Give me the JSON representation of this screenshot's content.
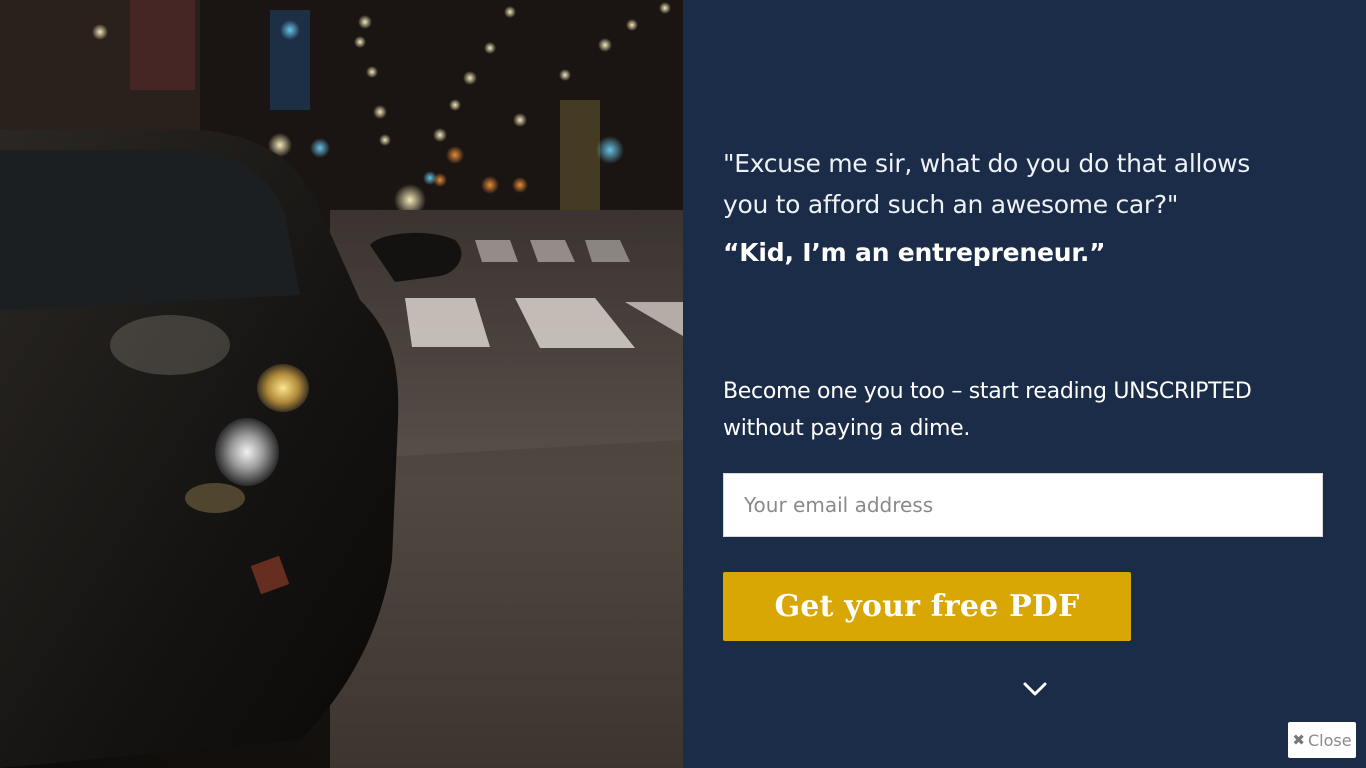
{
  "popup": {
    "quote": "\"Excuse me sir, what do you do that allows you to afford such an awesome car?\"",
    "answer": "“Kid, I’m an entrepreneur.”",
    "subtext": "Become one you too – start reading UNSCRIPTED without paying a dime.",
    "email_placeholder": "Your email address",
    "cta_label": "Get your free PDF",
    "close_label": "Close",
    "icons": {
      "close": "close-icon",
      "scroll": "chevron-down-icon"
    },
    "colors": {
      "panel_bg": "#1b2c48",
      "cta_bg": "#d9a704"
    }
  }
}
